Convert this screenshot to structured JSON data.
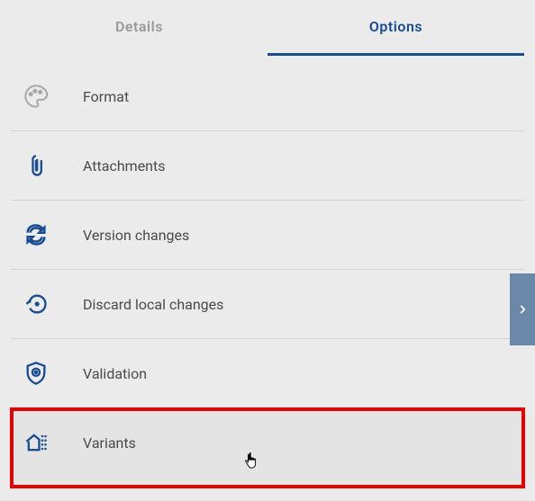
{
  "tabs": {
    "details": "Details",
    "options": "Options"
  },
  "items": [
    {
      "label": "Format",
      "icon": "palette-icon"
    },
    {
      "label": "Attachments",
      "icon": "paperclip-icon"
    },
    {
      "label": "Version changes",
      "icon": "sync-icon"
    },
    {
      "label": "Discard local changes",
      "icon": "restore-icon"
    },
    {
      "label": "Validation",
      "icon": "shield-check-icon"
    },
    {
      "label": "Variants",
      "icon": "home-variants-icon"
    }
  ],
  "colors": {
    "accent": "#1a4d8f",
    "text": "#4a4a4a",
    "muted": "#999",
    "highlight": "#e60000",
    "navArrow": "#6b88a8"
  }
}
